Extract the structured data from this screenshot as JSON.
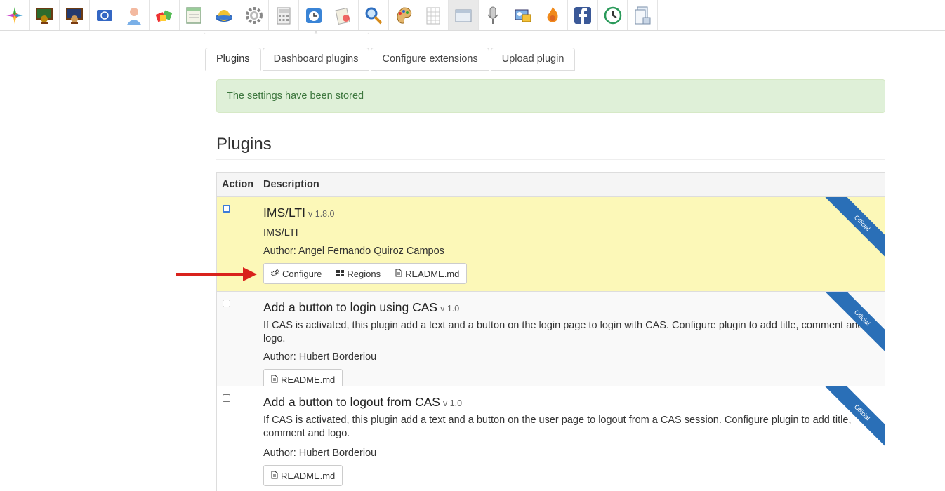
{
  "toolbar": {
    "icons": [
      "chamilo-logo-icon",
      "course-board-icon",
      "teacher-board-icon",
      "globe-flag-icon",
      "user-icon",
      "gift-boxes-icon",
      "browser-window-icon",
      "disk-icon",
      "gear-icon",
      "calculator-icon",
      "agenda-clock-icon",
      "search-doc-icon",
      "magnifier-icon",
      "palette-icon",
      "grid-doc-icon",
      "window-icon",
      "usb-mic-icon",
      "id-card-icon",
      "fire-badge-icon",
      "facebook-icon",
      "clock-icon",
      "document-stack-icon"
    ]
  },
  "tabs": [
    {
      "label": "Plugins",
      "active": true
    },
    {
      "label": "Dashboard plugins",
      "active": false
    },
    {
      "label": "Configure extensions",
      "active": false
    },
    {
      "label": "Upload plugin",
      "active": false
    }
  ],
  "alert": {
    "text": "The settings have been stored"
  },
  "page_title": "Plugins",
  "table": {
    "header": {
      "action": "Action",
      "description": "Description"
    },
    "rows": [
      {
        "name": "IMS/LTI",
        "version": "v 1.8.0",
        "description": "IMS/LTI",
        "author": "Author: Angel Fernando Quiroz Campos",
        "ribbon": "Official",
        "buttons": {
          "configure": "Configure",
          "regions": "Regions",
          "readme": "README.md"
        }
      },
      {
        "name": "Add a button to login using CAS",
        "version": "v 1.0",
        "description": "If CAS is activated, this plugin add a text and a button on the login page to login with CAS. Configure plugin to add title, comment and logo.",
        "author": "Author: Hubert Borderiou",
        "ribbon": "Official",
        "buttons": {
          "readme": "README.md"
        }
      },
      {
        "name": "Add a button to logout from CAS",
        "version": "v 1.0",
        "description": "If CAS is activated, this plugin add a text and a button on the user page to logout from a CAS session. Configure plugin to add title, comment and logo.",
        "author": "Author: Hubert Borderiou",
        "ribbon": "Official",
        "buttons": {
          "readme": "README.md"
        }
      }
    ]
  },
  "colors": {
    "alert_bg": "#dff0d8",
    "alert_text": "#3c763d",
    "selected_row": "#fcf8b8",
    "ribbon": "#2a6fb7",
    "arrow": "#d9221c"
  }
}
